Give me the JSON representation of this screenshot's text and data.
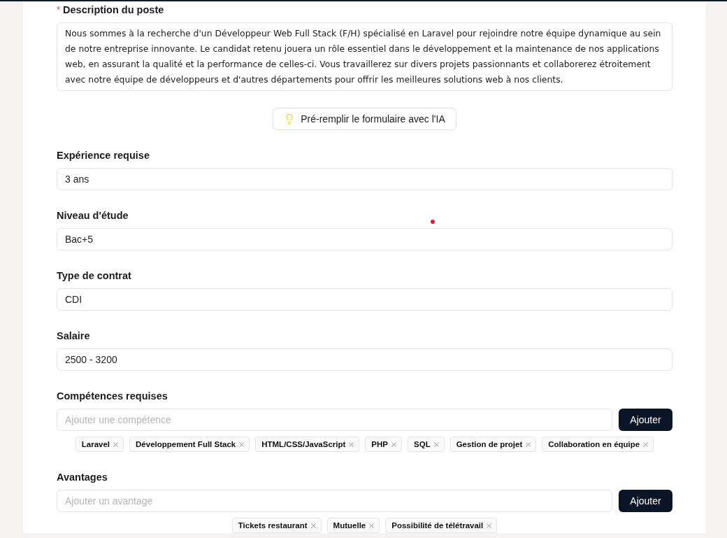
{
  "description": {
    "required_mark": "*",
    "label": "Description du poste",
    "value": "Nous sommes à la recherche d'un Développeur Web Full Stack (F/H) spécialisé en Laravel pour rejoindre notre équipe dynamique au sein de notre entreprise innovante. Le candidat retenu jouera un rôle essentiel dans le développement et la maintenance de nos applications web, en assurant la qualité et la performance de celles-ci. Vous travaillerez sur divers projets passionnants et collaborerez étroitement avec notre équipe de développeurs et d'autres départements pour offrir les meilleures solutions web à nos clients."
  },
  "ai_button": {
    "label": "Pré-remplir le formulaire avec l'IA"
  },
  "fields": [
    {
      "label": "Expérience requise",
      "value": "3 ans"
    },
    {
      "label": "Niveau d'étude",
      "value": "Bac+5"
    },
    {
      "label": "Type de contrat",
      "value": "CDI"
    },
    {
      "label": "Salaire",
      "value": "2500 - 3200"
    }
  ],
  "tag_groups": [
    {
      "label": "Compétences requises",
      "placeholder": "Ajouter une compétence",
      "button": "Ajouter",
      "tags": [
        "Laravel",
        "Développement Full Stack",
        "HTML/CSS/JavaScript",
        "PHP",
        "SQL",
        "Gestion de projet",
        "Collaboration en équipe"
      ]
    },
    {
      "label": "Avantages",
      "placeholder": "Ajouter un avantage",
      "button": "Ajouter",
      "tags": [
        "Tickets restaurant",
        "Mutuelle",
        "Possibilité de télétravail"
      ]
    }
  ]
}
